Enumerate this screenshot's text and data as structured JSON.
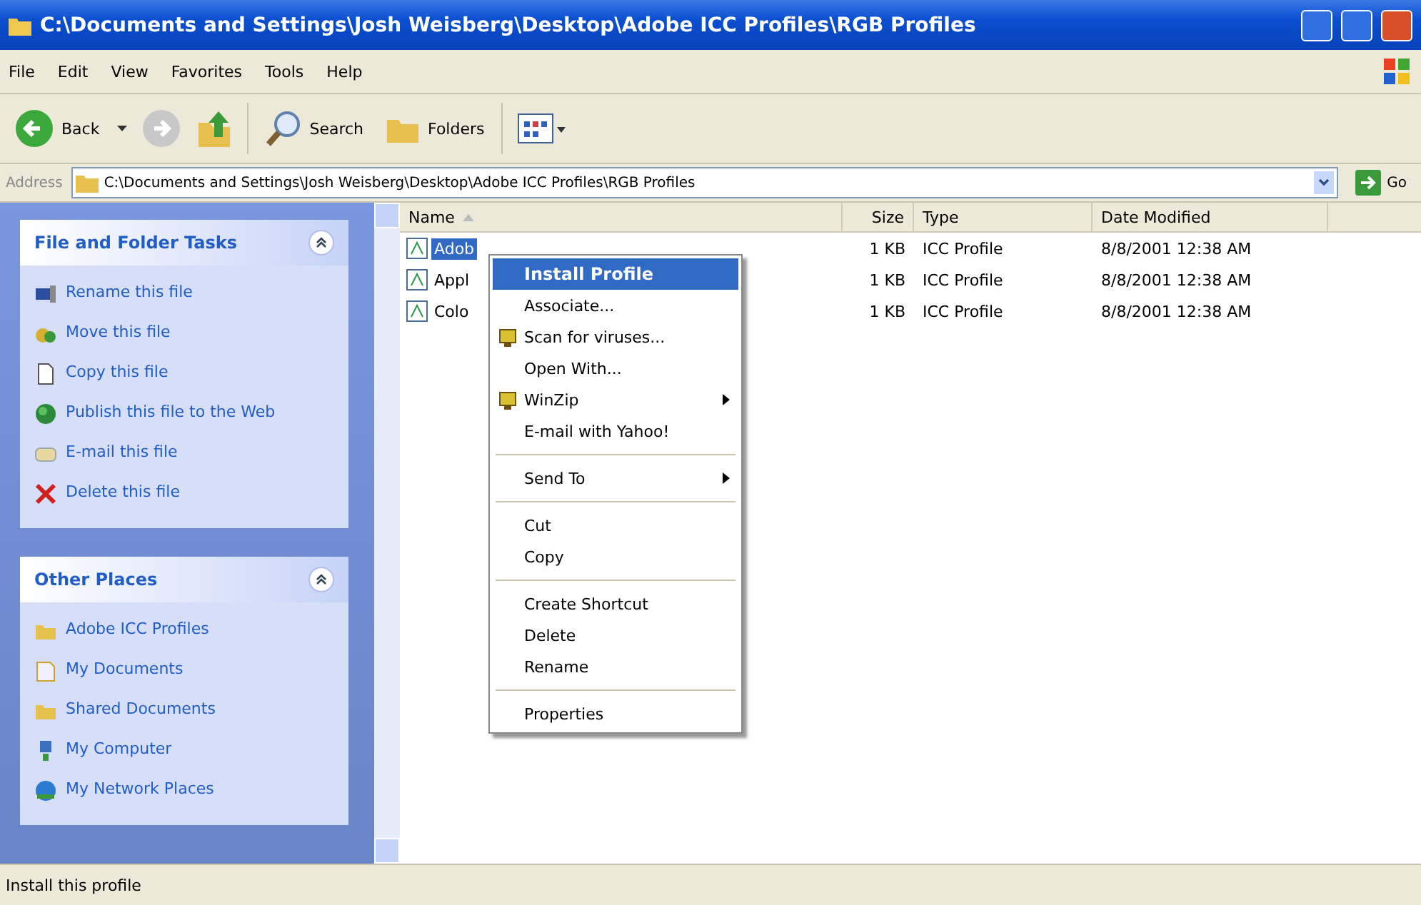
{
  "window": {
    "title": "C:\\Documents and Settings\\Josh Weisberg\\Desktop\\Adobe ICC Profiles\\RGB Profiles"
  },
  "menu_bar": [
    "File",
    "Edit",
    "View",
    "Favorites",
    "Tools",
    "Help"
  ],
  "toolbar": {
    "back": "Back",
    "search": "Search",
    "folders": "Folders"
  },
  "address_bar": {
    "label": "Address",
    "value": "C:\\Documents and Settings\\Josh Weisberg\\Desktop\\Adobe ICC Profiles\\RGB Profiles",
    "go": "Go"
  },
  "sidebar": {
    "panels": [
      {
        "title": "File and Folder Tasks",
        "expanded": true,
        "items": [
          "Rename this file",
          "Move this file",
          "Copy this file",
          "Publish this file to the Web",
          "E-mail this file",
          "Delete this file"
        ]
      },
      {
        "title": "Other Places",
        "expanded": true,
        "items": [
          "Adobe ICC Profiles",
          "My Documents",
          "Shared Documents",
          "My Computer",
          "My Network Places"
        ]
      }
    ]
  },
  "table": {
    "columns": [
      "Name",
      "Size",
      "Type",
      "Date Modified"
    ],
    "rows": [
      {
        "name": "Adob",
        "size": "1 KB",
        "type": "ICC Profile",
        "date": "8/8/2001 12:38 AM",
        "selected": true
      },
      {
        "name": "Appl",
        "size": "1 KB",
        "type": "ICC Profile",
        "date": "8/8/2001 12:38 AM",
        "selected": false
      },
      {
        "name": "Colo",
        "size": "1 KB",
        "type": "ICC Profile",
        "date": "8/8/2001 12:38 AM",
        "selected": false
      }
    ]
  },
  "context_menu": [
    {
      "kind": "item",
      "label": "Install Profile",
      "selected": true,
      "has_icon": false,
      "submenu": false
    },
    {
      "kind": "item",
      "label": "Associate...",
      "selected": false,
      "has_icon": false,
      "submenu": false
    },
    {
      "kind": "item",
      "label": "Scan for viruses...",
      "selected": false,
      "has_icon": true,
      "submenu": false
    },
    {
      "kind": "item",
      "label": "Open With...",
      "selected": false,
      "has_icon": false,
      "submenu": false
    },
    {
      "kind": "item",
      "label": "WinZip",
      "selected": false,
      "has_icon": true,
      "submenu": true
    },
    {
      "kind": "item",
      "label": "E-mail with Yahoo!",
      "selected": false,
      "has_icon": false,
      "submenu": false
    },
    {
      "kind": "separator"
    },
    {
      "kind": "item",
      "label": "Send To",
      "selected": false,
      "has_icon": false,
      "submenu": true
    },
    {
      "kind": "separator"
    },
    {
      "kind": "item",
      "label": "Cut",
      "selected": false,
      "has_icon": false,
      "submenu": false
    },
    {
      "kind": "item",
      "label": "Copy",
      "selected": false,
      "has_icon": false,
      "submenu": false
    },
    {
      "kind": "separator"
    },
    {
      "kind": "item",
      "label": "Create Shortcut",
      "selected": false,
      "has_icon": false,
      "submenu": false
    },
    {
      "kind": "item",
      "label": "Delete",
      "selected": false,
      "has_icon": false,
      "submenu": false
    },
    {
      "kind": "item",
      "label": "Rename",
      "selected": false,
      "has_icon": false,
      "submenu": false
    },
    {
      "kind": "separator"
    },
    {
      "kind": "item",
      "label": "Properties",
      "selected": false,
      "has_icon": false,
      "submenu": false
    }
  ],
  "status_bar": "Install this profile"
}
